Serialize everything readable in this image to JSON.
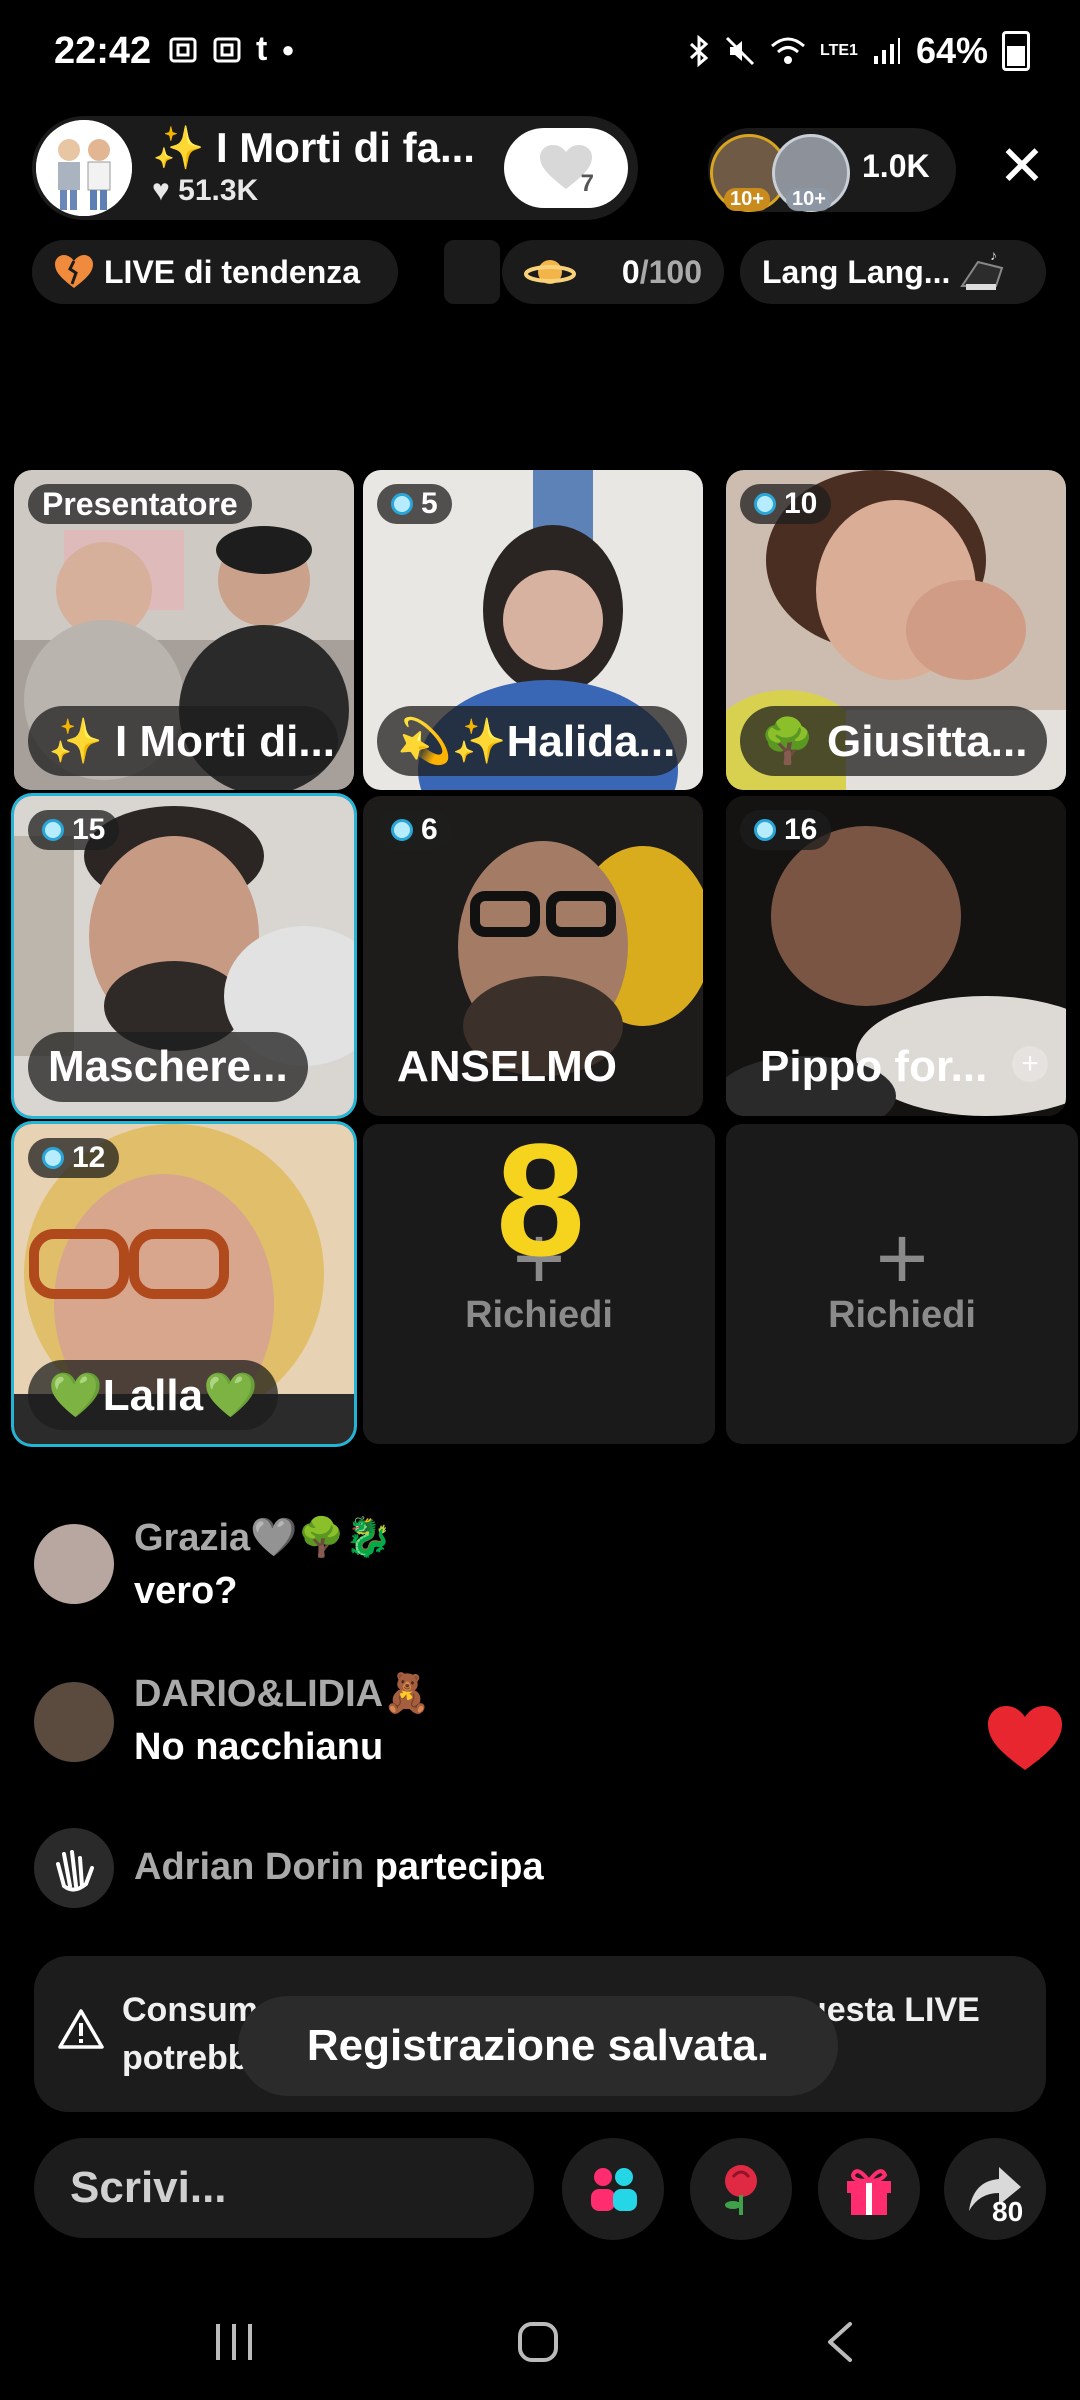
{
  "status_bar": {
    "time": "22:42",
    "extra_icon": "t",
    "battery": "64%",
    "network": "LTE1"
  },
  "host": {
    "name": "✨ I Morti di fa...",
    "likes": "51.3K",
    "follow_count": "7"
  },
  "viewers": {
    "badges": [
      "10+",
      "10+"
    ],
    "count": "1.0K"
  },
  "chips": {
    "trending": "LIVE di tendenza",
    "goal": "0/100",
    "goal_done": "0",
    "goal_total": "/100",
    "music": "Lang Lang..."
  },
  "guests": [
    {
      "tag": "Presentatore",
      "name": "✨ I Morti di..."
    },
    {
      "tag": "5",
      "name": "💫✨Halida..."
    },
    {
      "tag": "10",
      "name": "🌳 Giusitta..."
    },
    {
      "tag": "15",
      "name": "Maschere..."
    },
    {
      "tag": "6",
      "name": "ANSELMO"
    },
    {
      "tag": "16",
      "name": "Pippo for..."
    },
    {
      "tag": "12",
      "name": "💚Lalla💚"
    }
  ],
  "request_slots": [
    {
      "label": "Richiedi"
    },
    {
      "label": "Richiedi"
    }
  ],
  "overlay_number": "8",
  "chat": [
    {
      "user": "Grazia🩶🌳🐉",
      "message": "vero?"
    },
    {
      "user": "DARIO&LIDIA🧸",
      "message": "No nacchianu"
    },
    {
      "user": "Adrian Dorin",
      "message": "partecipa"
    }
  ],
  "warning": "Consumare le sostanze rappresentate in questa LIVE potrebbe essere dannoso per la tua salute.",
  "toast": "Registrazione salvata.",
  "input": {
    "placeholder": "Scrivi..."
  },
  "share_count": "80",
  "colors": {
    "accent_pink": "#ff2d6f",
    "accent_cyan": "#22b5d6",
    "heart_red": "#e8262f",
    "gold": "#f6d31c"
  }
}
